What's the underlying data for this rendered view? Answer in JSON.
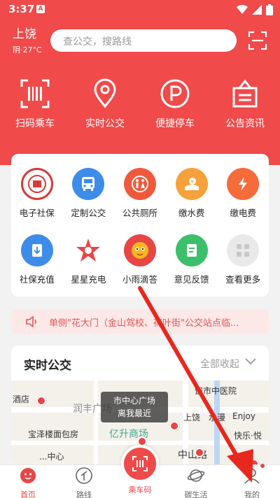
{
  "status": {
    "time": "3:37"
  },
  "header": {
    "city": "上饶",
    "weather": "阴·27°C",
    "search_placeholder": "查公交，搜路线"
  },
  "quick_actions": [
    {
      "label": "扫码乘车",
      "icon": "qr-scan-icon"
    },
    {
      "label": "实时公交",
      "icon": "location-pin-icon"
    },
    {
      "label": "便捷停车",
      "icon": "parking-icon"
    },
    {
      "label": "公告资讯",
      "icon": "announcement-icon"
    }
  ],
  "services": [
    {
      "label": "电子社保",
      "icon": "social-security-seal-icon",
      "color": "#d43b3b"
    },
    {
      "label": "定制公交",
      "icon": "bus-icon",
      "color": "#3d8de8"
    },
    {
      "label": "公共厕所",
      "icon": "restroom-icon",
      "color": "#f05a3c"
    },
    {
      "label": "缴水费",
      "icon": "water-bill-icon",
      "color": "#f7a13a"
    },
    {
      "label": "缴电费",
      "icon": "lightning-icon",
      "color": "#f56c3a"
    },
    {
      "label": "社保充值",
      "icon": "recharge-down-icon",
      "color": "#3d8de8"
    },
    {
      "label": "星星充电",
      "icon": "star-charging-icon",
      "color": "#e84545"
    },
    {
      "label": "小雨滴答",
      "icon": "mascot-icon",
      "color": "#e84545"
    },
    {
      "label": "意见反馈",
      "icon": "feedback-icon",
      "color": "#3cbf6b"
    },
    {
      "label": "查看更多",
      "icon": "more-grid-icon",
      "color": "#d8d8d8"
    }
  ],
  "notice": {
    "text": "单侧\"花大门（金山驾校、荷叶街\"公交站点临..."
  },
  "realtime": {
    "title": "实时公交",
    "collapse_label": "全部收起",
    "map_labels": [
      "酒店",
      "润丰广场",
      "宝泽楼面包房",
      "亿升商场",
      "饶市中医院",
      "上饶",
      "水漫",
      "Enjoy",
      "快乐·悦",
      "中山路",
      "...中心"
    ],
    "popup_title": "市中心广场",
    "popup_subtitle": "离我最近"
  },
  "tabbar": {
    "home": "首页",
    "route": "路线",
    "center": "乘车码",
    "carbon": "碳生活",
    "mine": "我的"
  },
  "colors": {
    "brand": "#f04a4a",
    "notice_bg": "#fde8e8"
  }
}
